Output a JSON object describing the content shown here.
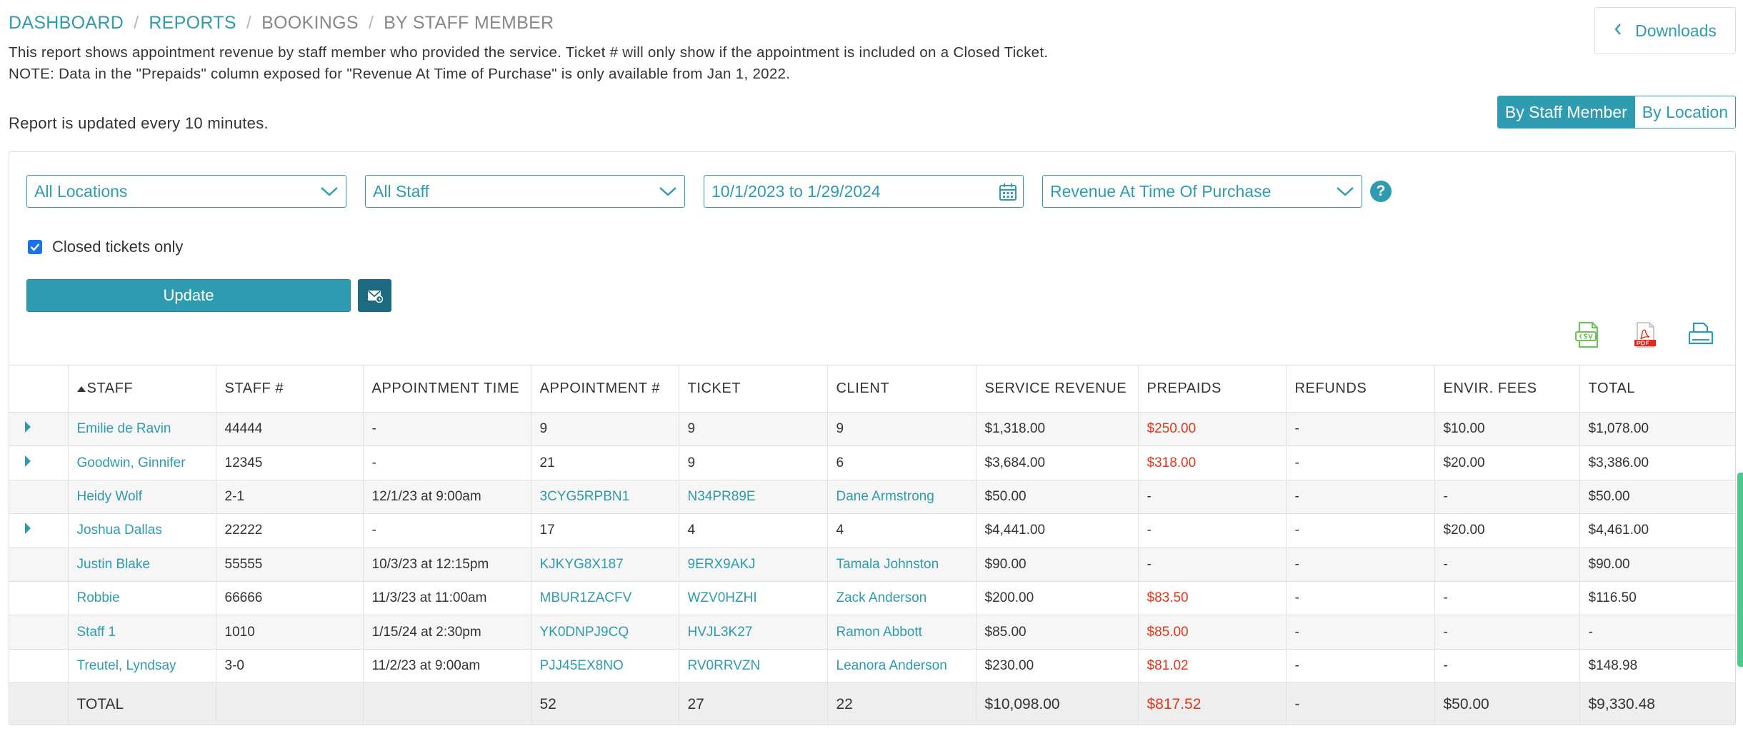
{
  "breadcrumb": {
    "dashboard": "DASHBOARD",
    "reports": "REPORTS",
    "bookings": "BOOKINGS",
    "current": "BY STAFF MEMBER",
    "separator": "/"
  },
  "description": {
    "line1": "This report shows appointment revenue by staff member who provided the service. Ticket # will only show if the appointment is included on a Closed Ticket.",
    "line2": "NOTE: Data in the \"Prepaids\" column exposed for \"Revenue At Time of Purchase\" is only available from Jan 1, 2022.",
    "updated": "Report is updated every 10 minutes."
  },
  "downloads_label": "Downloads",
  "view_toggle": {
    "by_staff": "By Staff Member",
    "by_location": "By Location",
    "selected": "By Staff Member"
  },
  "filters": {
    "location": "All Locations",
    "staff": "All Staff",
    "date_range": "10/1/2023 to 1/29/2024",
    "revenue_mode": "Revenue At Time Of Purchase",
    "help": "?",
    "closed_tickets_label": "Closed tickets only",
    "closed_tickets_checked": true
  },
  "update_label": "Update",
  "table": {
    "columns": [
      "STAFF",
      "STAFF #",
      "APPOINTMENT TIME",
      "APPOINTMENT #",
      "TICKET",
      "CLIENT",
      "SERVICE REVENUE",
      "PREPAIDS",
      "REFUNDS",
      "ENVIR. FEES",
      "TOTAL"
    ],
    "rows": [
      {
        "expand": true,
        "staff": "Emilie de Ravin",
        "staff_no": "44444",
        "time": "-",
        "appt": "9",
        "ticket": "9",
        "client": "9",
        "service": "$1,318.00",
        "prepaids": "$250.00",
        "refunds": "-",
        "fees": "$10.00",
        "total": "$1,078.00"
      },
      {
        "expand": true,
        "staff": "Goodwin, Ginnifer",
        "staff_no": "12345",
        "time": "-",
        "appt": "21",
        "ticket": "9",
        "client": "6",
        "service": "$3,684.00",
        "prepaids": "$318.00",
        "refunds": "-",
        "fees": "$20.00",
        "total": "$3,386.00"
      },
      {
        "expand": false,
        "staff": "Heidy Wolf",
        "staff_no": "2-1",
        "time": "12/1/23 at 9:00am",
        "appt": "3CYG5RPBN1",
        "ticket": "N34PR89E",
        "client": "Dane Armstrong",
        "service": "$50.00",
        "prepaids": "-",
        "refunds": "-",
        "fees": "-",
        "total": "$50.00"
      },
      {
        "expand": true,
        "staff": "Joshua Dallas",
        "staff_no": "22222",
        "time": "-",
        "appt": "17",
        "ticket": "4",
        "client": "4",
        "service": "$4,441.00",
        "prepaids": "-",
        "refunds": "-",
        "fees": "$20.00",
        "total": "$4,461.00"
      },
      {
        "expand": false,
        "staff": "Justin Blake",
        "staff_no": "55555",
        "time": "10/3/23 at 12:15pm",
        "appt": "KJKYG8X187",
        "ticket": "9ERX9AKJ",
        "client": "Tamala Johnston",
        "service": "$90.00",
        "prepaids": "-",
        "refunds": "-",
        "fees": "-",
        "total": "$90.00"
      },
      {
        "expand": false,
        "staff": "Robbie",
        "staff_no": "66666",
        "time": "11/3/23 at 11:00am",
        "appt": "MBUR1ZACFV",
        "ticket": "WZV0HZHI",
        "client": "Zack Anderson",
        "service": "$200.00",
        "prepaids": "$83.50",
        "refunds": "-",
        "fees": "-",
        "total": "$116.50"
      },
      {
        "expand": false,
        "staff": "Staff 1",
        "staff_no": "1010",
        "time": "1/15/24 at 2:30pm",
        "appt": "YK0DNPJ9CQ",
        "ticket": "HVJL3K27",
        "client": "Ramon Abbott",
        "service": "$85.00",
        "prepaids": "$85.00",
        "refunds": "-",
        "fees": "-",
        "total": "-"
      },
      {
        "expand": false,
        "staff": "Treutel, Lyndsay",
        "staff_no": "3-0",
        "time": "11/2/23 at 9:00am",
        "appt": "PJJ45EX8NO",
        "ticket": "RV0RRVZN",
        "client": "Leanora Anderson",
        "service": "$230.00",
        "prepaids": "$81.02",
        "refunds": "-",
        "fees": "-",
        "total": "$148.98"
      }
    ],
    "totals": {
      "label": "TOTAL",
      "staff_no": "",
      "time": "",
      "appt": "52",
      "ticket": "27",
      "client": "22",
      "service": "$10,098.00",
      "prepaids": "$817.52",
      "refunds": "-",
      "fees": "$50.00",
      "total": "$9,330.48"
    }
  },
  "icons": {
    "downloads": "chevron-left-icon",
    "calendar": "calendar-icon",
    "csv": "csv-icon",
    "pdf": "pdf-icon",
    "print": "print-icon",
    "schedule": "schedule-email-icon",
    "expand": "expand-triangle-icon",
    "sort": "sort-ascending-icon"
  },
  "colors": {
    "accent": "#2e9bb0",
    "negative": "#e0381b",
    "csv": "#6fbf5a",
    "pdf": "#e0281b"
  }
}
